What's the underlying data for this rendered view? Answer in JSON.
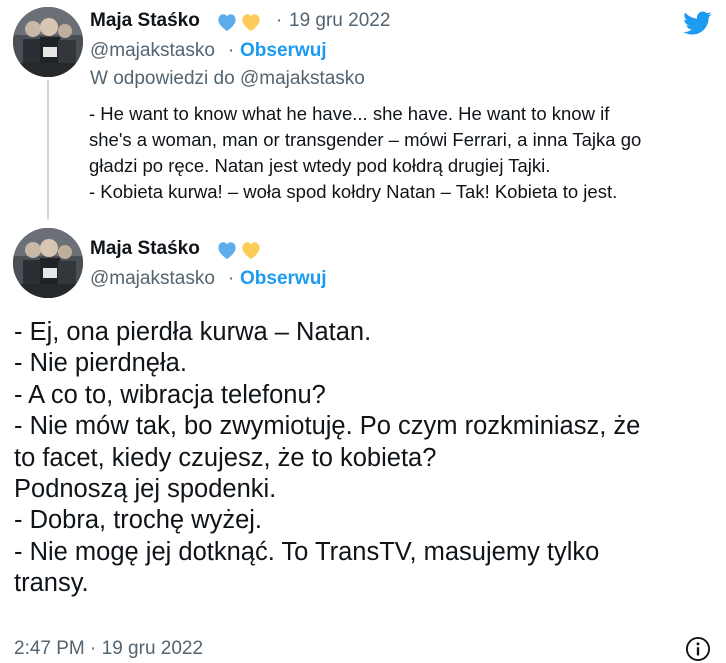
{
  "tweets": [
    {
      "author_name": "Maja Staśko",
      "hearts": [
        "blue-heart",
        "yellow-heart"
      ],
      "separator": "·",
      "date": "19 gru 2022",
      "handle": "@majakstasko",
      "handle_sep": "·",
      "follow_label": "Obserwuj",
      "reply_to": "W odpowiedzi do @majakstasko",
      "text_lines": [
        "- He want to know what he have... she have. He want to know if",
        "she's a woman, man or transgender – mówi Ferrari, a inna Tajka go",
        "gładzi po ręce. Natan jest wtedy pod kołdrą drugiej Tajki.",
        "- Kobieta kurwa! – woła spod kołdry Natan – Tak! Kobieta to jest."
      ]
    },
    {
      "author_name": "Maja Staśko",
      "hearts": [
        "blue-heart",
        "yellow-heart"
      ],
      "handle": "@majakstasko",
      "handle_sep": "·",
      "follow_label": "Obserwuj",
      "text_lines": [
        "- Ej, ona pierdła kurwa – Natan.",
        "- Nie pierdnęła.",
        "- A co to, wibracja telefonu?",
        "- Nie mów tak, bo zwymiotuję. Po czym rozkminiasz, że",
        "to facet, kiedy czujesz, że to kobieta?",
        "Podnoszą jej spodenki.",
        "- Dobra, trochę wyżej.",
        "- Nie mogę jej dotknąć. To TransTV, masujemy tylko",
        "transy."
      ],
      "timestamp": "2:47 PM · 19 gru 2022"
    }
  ],
  "icons": {
    "brand": "twitter-bird-icon",
    "info": "info-icon"
  },
  "colors": {
    "accent": "#1d9bf0",
    "text": "#0f1419",
    "secondary": "#536471",
    "heart_blue": "#5dadec",
    "heart_yellow": "#fdcb58",
    "thread_line": "#cfd9de"
  }
}
